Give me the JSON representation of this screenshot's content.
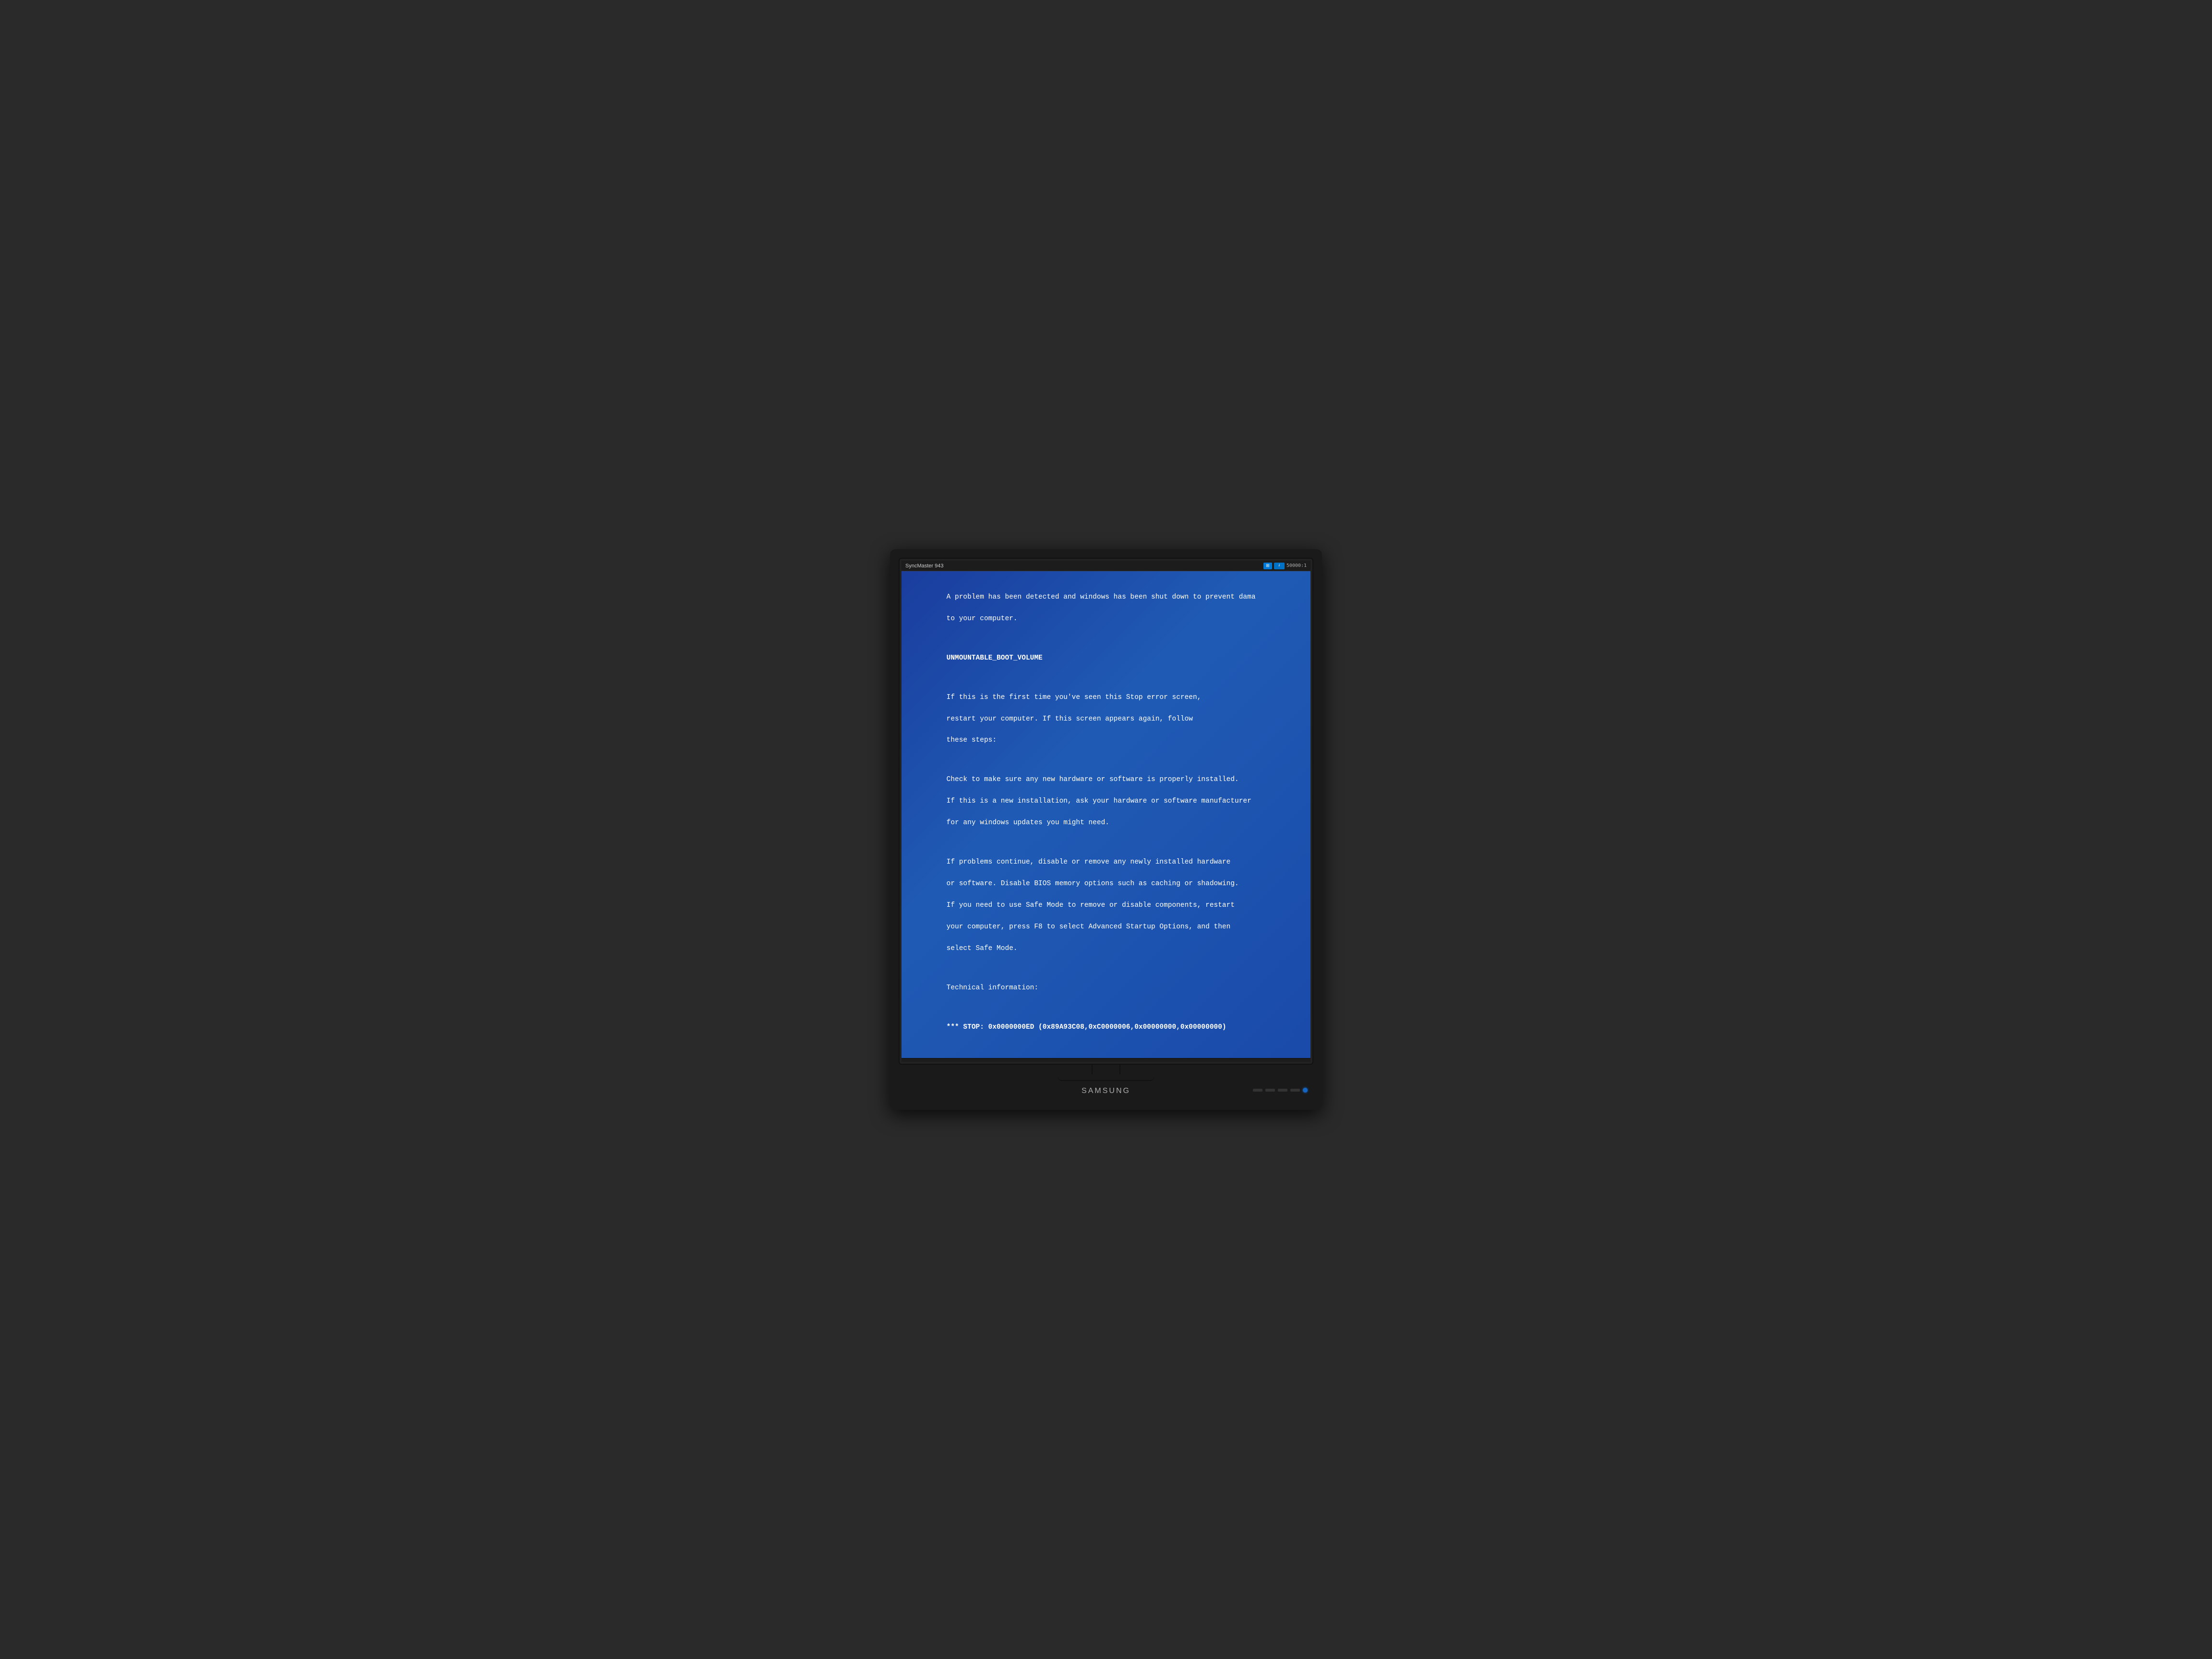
{
  "monitor": {
    "model": "SyncMaster 943",
    "resolution": "50000:1",
    "brand": "SAMSUNG"
  },
  "bsod": {
    "line1": "A problem has been detected and windows has been shut down to prevent dama",
    "line2": "to your computer.",
    "error_code": "UNMOUNTABLE_BOOT_VOLUME",
    "paragraph1_line1": "If this is the first time you've seen this Stop error screen,",
    "paragraph1_line2": "restart your computer. If this screen appears again, follow",
    "paragraph1_line3": "these steps:",
    "paragraph2_line1": "Check to make sure any new hardware or software is properly installed.",
    "paragraph2_line2": "If this is a new installation, ask your hardware or software manufacturer",
    "paragraph2_line3": "for any windows updates you might need.",
    "paragraph3_line1": "If problems continue, disable or remove any newly installed hardware",
    "paragraph3_line2": "or software. Disable BIOS memory options such as caching or shadowing.",
    "paragraph3_line3": "If you need to use Safe Mode to remove or disable components, restart",
    "paragraph3_line4": "your computer, press F8 to select Advanced Startup Options, and then",
    "paragraph3_line5": "select Safe Mode.",
    "tech_info_label": "Technical information:",
    "stop_code": "*** STOP: 0x0000000ED (0x89A93C08,0xC0000006,0x00000000,0x00000000)"
  }
}
